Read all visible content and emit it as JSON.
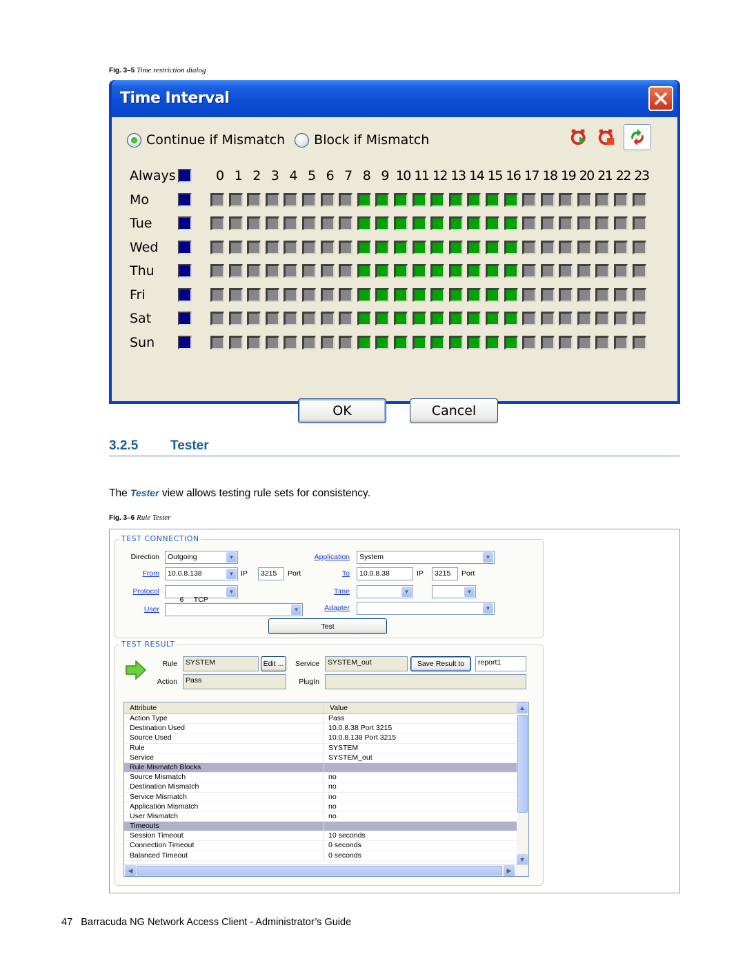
{
  "figure1": {
    "caption_num": "Fig. 3–5",
    "caption_text": "Time restriction dialog"
  },
  "dialog": {
    "title": "Time Interval",
    "radio_continue": "Continue if Mismatch",
    "radio_block": "Block if Mismatch",
    "selected_mode": "continue",
    "always_label": "Always",
    "hours": [
      "0",
      "1",
      "2",
      "3",
      "4",
      "5",
      "6",
      "7",
      "8",
      "9",
      "10",
      "11",
      "12",
      "13",
      "14",
      "15",
      "16",
      "17",
      "18",
      "19",
      "20",
      "21",
      "22",
      "23"
    ],
    "days": [
      {
        "label": "Mo",
        "active_hours": [
          8,
          9,
          10,
          11,
          12,
          13,
          14,
          15,
          16
        ]
      },
      {
        "label": "Tue",
        "active_hours": [
          8,
          9,
          10,
          11,
          12,
          13,
          14,
          15,
          16
        ]
      },
      {
        "label": "Wed",
        "active_hours": [
          8,
          9,
          10,
          11,
          12,
          13,
          14,
          15,
          16
        ]
      },
      {
        "label": "Thu",
        "active_hours": [
          8,
          9,
          10,
          11,
          12,
          13,
          14,
          15,
          16
        ]
      },
      {
        "label": "Fri",
        "active_hours": [
          8,
          9,
          10,
          11,
          12,
          13,
          14,
          15,
          16
        ]
      },
      {
        "label": "Sat",
        "active_hours": [
          8,
          9,
          10,
          11,
          12,
          13,
          14,
          15,
          16
        ]
      },
      {
        "label": "Sun",
        "active_hours": [
          8,
          9,
          10,
          11,
          12,
          13,
          14,
          15,
          16
        ]
      }
    ],
    "colors": {
      "active": "#00a400",
      "inactive": "#868686",
      "day_toggle": "#00008b"
    },
    "ok_label": "OK",
    "cancel_label": "Cancel"
  },
  "section": {
    "number": "3.2.5",
    "title": "Tester",
    "body_prefix": "The ",
    "body_emphasis": "Tester",
    "body_suffix": " view allows testing rule sets for consistency."
  },
  "figure2": {
    "caption_num": "Fig. 3–6",
    "caption_text": "Rule Tester"
  },
  "tester": {
    "test_connection": {
      "title": "TEST CONNECTION",
      "direction_label": "Direction",
      "direction_value": "Outgoing",
      "from_label": "From",
      "from_value": "10.0.8.138",
      "from_port": "3215",
      "ip_label": "IP",
      "port_label": "Port",
      "protocol_label": "Protocol",
      "protocol_value": "6     TCP",
      "user_label": "User",
      "user_value": "",
      "application_label": "Application",
      "application_value": "System",
      "to_label": "To",
      "to_value": "10.0.8.38",
      "to_port": "3215",
      "time_label": "Time",
      "time_value_1": "",
      "time_value_2": "",
      "adapter_label": "Adapter",
      "adapter_value": "",
      "test_button": "Test"
    },
    "test_result": {
      "title": "TEST RESULT",
      "rule_label": "Rule",
      "rule_value": "SYSTEM",
      "edit_button": "Edit ...",
      "service_label": "Service",
      "service_value": "SYSTEM_out",
      "save_button": "Save Result  to",
      "save_target": "report1",
      "action_label": "Action",
      "action_value": "Pass",
      "plugin_label": "PlugIn",
      "plugin_value": ""
    },
    "table": {
      "headers": [
        "Attribute",
        "Value"
      ],
      "rows": [
        {
          "attr": "Action Type",
          "value": "Pass",
          "section": false
        },
        {
          "attr": "Destination Used",
          "value": "10.0.8.38 Port 3215",
          "section": false
        },
        {
          "attr": "Source Used",
          "value": "10.0.8.138 Port 3215",
          "section": false
        },
        {
          "attr": "Rule",
          "value": "SYSTEM",
          "section": false
        },
        {
          "attr": "Service",
          "value": "SYSTEM_out",
          "section": false
        },
        {
          "attr": "Rule Mismatch Blocks",
          "value": "",
          "section": true
        },
        {
          "attr": "Source Mismatch",
          "value": "no",
          "section": false
        },
        {
          "attr": "Destination Mismatch",
          "value": "no",
          "section": false
        },
        {
          "attr": "Service Mismatch",
          "value": "no",
          "section": false
        },
        {
          "attr": "Application Mismatch",
          "value": "no",
          "section": false
        },
        {
          "attr": "User Mismatch",
          "value": "no",
          "section": false
        },
        {
          "attr": "Timeouts",
          "value": "",
          "section": true
        },
        {
          "attr": "Session Timeout",
          "value": "10 seconds",
          "section": false
        },
        {
          "attr": "Connection Timeout",
          "value": "0 seconds",
          "section": false
        },
        {
          "attr": "Balanced Timeout",
          "value": "0 seconds",
          "section": false
        }
      ]
    }
  },
  "footer": {
    "page_number": "47",
    "text": "Barracuda NG Network Access Client - Administrator’s Guide"
  }
}
